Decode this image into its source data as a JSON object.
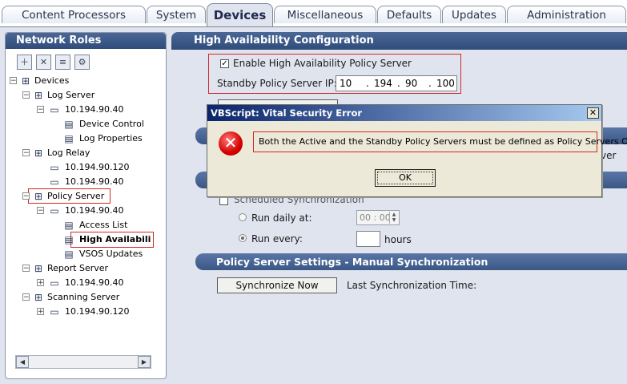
{
  "tabs": [
    {
      "label": "Content Processors",
      "active": false
    },
    {
      "label": "System",
      "active": false
    },
    {
      "label": "Devices",
      "active": true
    },
    {
      "label": "Miscellaneous",
      "active": false
    },
    {
      "label": "Defaults",
      "active": false
    },
    {
      "label": "Updates",
      "active": false
    },
    {
      "label": "Administration",
      "active": false
    }
  ],
  "left_panel": {
    "title": "Network Roles",
    "toolbar_icons": [
      "add-node-icon",
      "delete-node-icon",
      "edit-node-icon",
      "properties-node-icon"
    ],
    "tree": [
      {
        "label": "Devices",
        "icon": "network-group-icon",
        "expander": "−"
      },
      {
        "label": "Log Server",
        "icon": "network-group-icon",
        "expander": "−"
      },
      {
        "label": "10.194.90.40",
        "icon": "computer-icon",
        "expander": "−"
      },
      {
        "label": "Device Control",
        "icon": "document-icon",
        "expander": ""
      },
      {
        "label": "Log Properties",
        "icon": "document-icon",
        "expander": ""
      },
      {
        "label": "Log Relay",
        "icon": "network-group-icon",
        "expander": "−"
      },
      {
        "label": "10.194.90.120",
        "icon": "computer-icon",
        "expander": ""
      },
      {
        "label": "10.194.90.40",
        "icon": "computer-icon",
        "expander": ""
      },
      {
        "label": "Policy Server",
        "icon": "network-group-icon",
        "expander": "−"
      },
      {
        "label": "10.194.90.40",
        "icon": "computer-icon",
        "expander": "−"
      },
      {
        "label": "Access List",
        "icon": "document-icon",
        "expander": ""
      },
      {
        "label": "High Availabili",
        "icon": "document-icon",
        "expander": ""
      },
      {
        "label": "VSOS Updates",
        "icon": "document-icon",
        "expander": ""
      },
      {
        "label": "Report Server",
        "icon": "network-group-icon",
        "expander": "−"
      },
      {
        "label": "10.194.90.40",
        "icon": "computer-icon",
        "expander": "+"
      },
      {
        "label": "Scanning Server",
        "icon": "network-group-icon",
        "expander": "−"
      },
      {
        "label": "10.194.90.120",
        "icon": "computer-icon",
        "expander": "+"
      }
    ]
  },
  "main": {
    "title": "High Availability Configuration",
    "enable_label": "Enable High Availability Policy Server",
    "enable_checked": true,
    "standby_label": "Standby Policy Server IP:",
    "ip": [
      "10",
      "194",
      "90",
      "100"
    ],
    "ip_dot": ".",
    "partial_right_text": "ver",
    "scheduled_label": "Scheduled Synchronization",
    "run_daily_label": "Run daily at:",
    "time_value": "00 : 00",
    "run_every_label": "Run every:",
    "run_every_value": "",
    "hours_label": "hours",
    "manual_section_title": "Policy Server Settings - Manual Synchronization",
    "sync_now_label": "Synchronize Now",
    "last_sync_label": "Last Synchronization Time:"
  },
  "dialog": {
    "title": "VBScript: Vital Security Error",
    "close_glyph": "✕",
    "message": "Both the Active and the Standby Policy Servers must be defined as Policy Servers Only.",
    "ok_label": "OK"
  }
}
